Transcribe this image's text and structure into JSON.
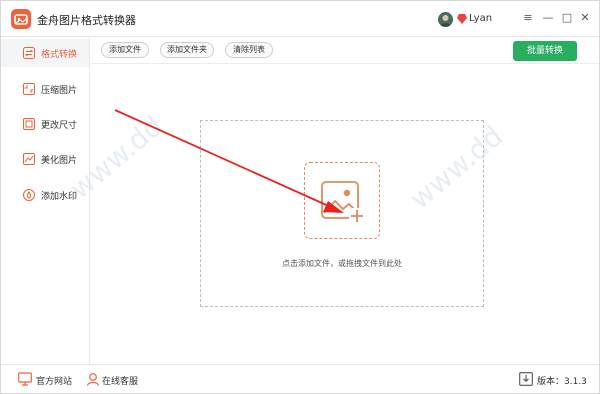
{
  "window": {
    "title": "金舟图片格式转换器",
    "username": "Lyan"
  },
  "window_controls": {
    "menu": "≡",
    "minimize": "—",
    "maximize": "□",
    "close": "✕"
  },
  "sidebar": {
    "items": [
      {
        "label": "格式转换",
        "icon": "format-convert-icon",
        "active": true
      },
      {
        "label": "压缩图片",
        "icon": "compress-icon",
        "active": false
      },
      {
        "label": "更改尺寸",
        "icon": "resize-icon",
        "active": false
      },
      {
        "label": "美化图片",
        "icon": "beautify-icon",
        "active": false
      },
      {
        "label": "添加水印",
        "icon": "watermark-icon",
        "active": false
      }
    ]
  },
  "toolbar": {
    "add_file": "添加文件",
    "add_folder": "添加文件夹",
    "clear_list": "清除列表",
    "batch_convert": "批量转换"
  },
  "dropzone": {
    "hint": "点击添加文件，或拖拽文件到此处"
  },
  "footer": {
    "website": "官方网站",
    "support": "在线客服",
    "version": "版本：3.1.3"
  },
  "colors": {
    "accent": "#f0623a",
    "green": "#27ae60",
    "arrow": "#e8231e"
  }
}
